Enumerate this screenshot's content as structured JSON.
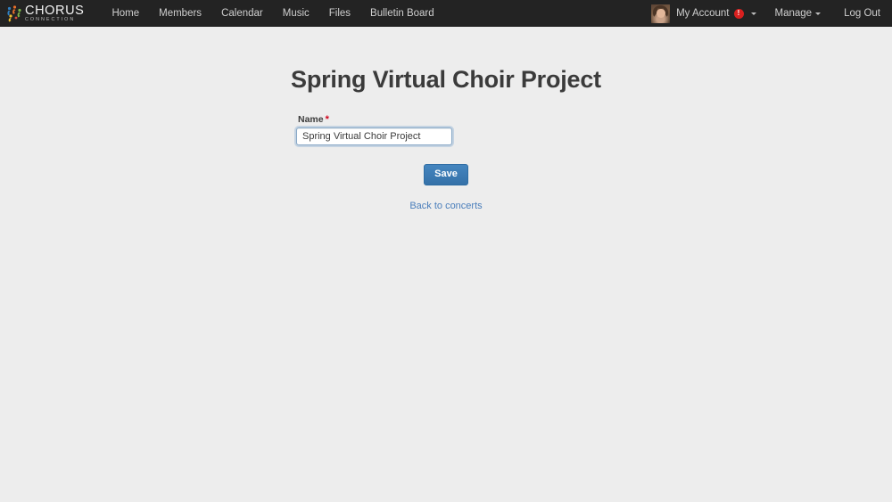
{
  "navbar": {
    "brand": {
      "icon": "chorus-people-logo-icon",
      "word": "CHORUS",
      "tagline": "CONNECTION"
    },
    "links": [
      {
        "label": "Home",
        "name": "nav-link-home"
      },
      {
        "label": "Members",
        "name": "nav-link-members"
      },
      {
        "label": "Calendar",
        "name": "nav-link-calendar"
      },
      {
        "label": "Music",
        "name": "nav-link-music"
      },
      {
        "label": "Files",
        "name": "nav-link-files"
      },
      {
        "label": "Bulletin Board",
        "name": "nav-link-bulletin-board"
      }
    ],
    "account": {
      "avatar_alt": "user-avatar",
      "label": "My Account",
      "badge": "!",
      "badge_color": "#d9201f",
      "caret": "caret-down-icon"
    },
    "manage": {
      "label": "Manage",
      "caret": "caret-down-icon"
    },
    "logout": {
      "label": "Log Out"
    }
  },
  "main": {
    "title": "Spring Virtual Choir Project",
    "form": {
      "name_field": {
        "label": "Name",
        "required_marker": "*",
        "value": "Spring Virtual Choir Project",
        "placeholder": ""
      },
      "save_button": "Save",
      "back_link": "Back to concerts"
    }
  },
  "theme": {
    "navbar_bg": "#232323",
    "page_bg": "#ededed",
    "primary": "#3b7cb8",
    "link": "#4a7ebb",
    "required": "#d0021b"
  }
}
